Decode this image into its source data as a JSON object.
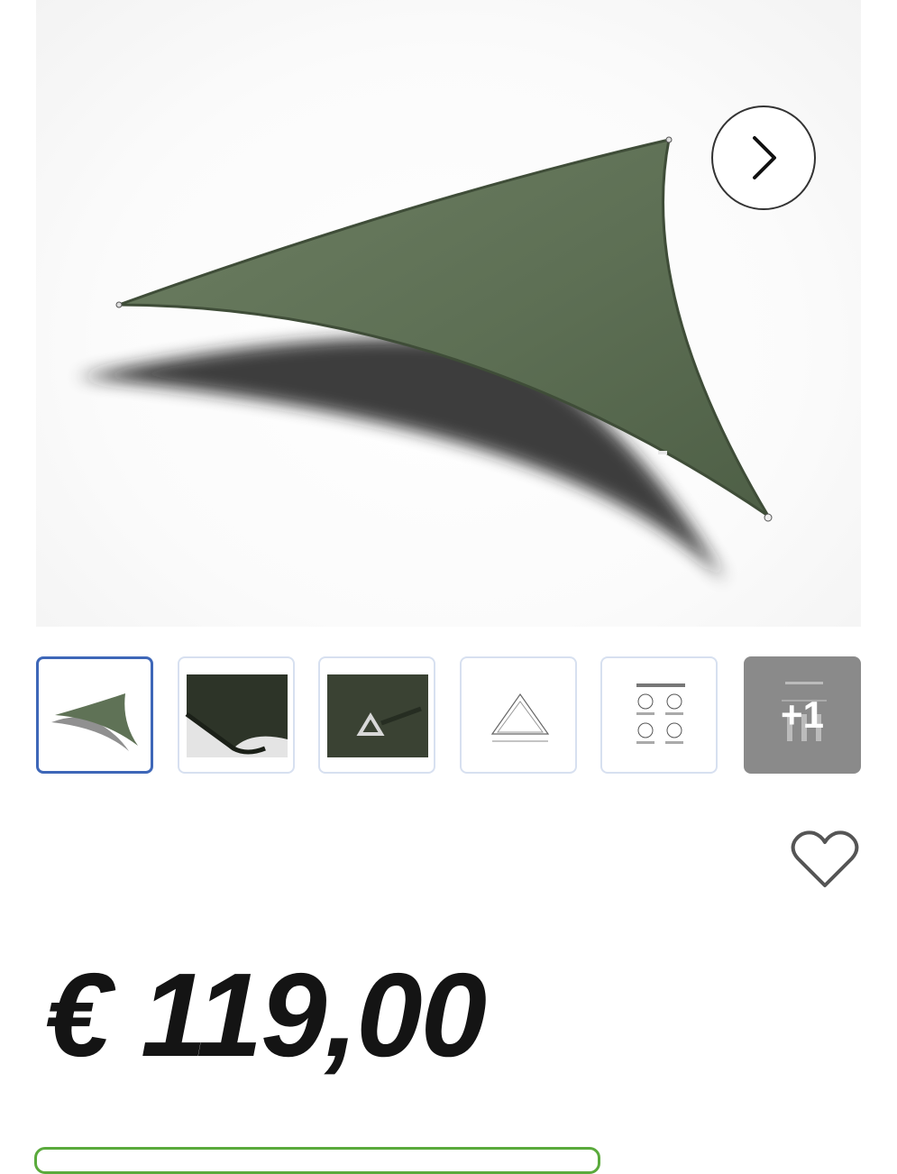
{
  "gallery": {
    "next_icon": "chevron-right-icon",
    "thumbnails": [
      {
        "label": "shade-sail-triangle",
        "active": true
      },
      {
        "label": "fabric-closeup-edge",
        "active": false
      },
      {
        "label": "fabric-closeup-ring",
        "active": false
      },
      {
        "label": "dimensions-diagram",
        "active": false
      },
      {
        "label": "easy-installation",
        "active": false
      },
      {
        "label": "easy-fixing",
        "active": false
      }
    ],
    "more_count": "+1"
  },
  "wishlist": {
    "icon": "heart-outline-icon"
  },
  "product": {
    "price": "€ 119,00"
  },
  "colors": {
    "sail": "#5f7256",
    "thumb_active_border": "#3e67b8",
    "thumb_border": "#d7e0f0",
    "cta_border": "#5aaa3c"
  }
}
